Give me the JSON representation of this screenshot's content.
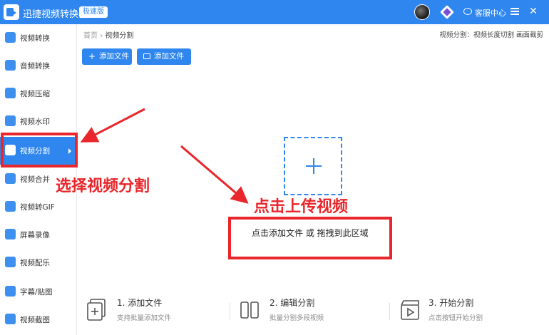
{
  "titlebar": {
    "app_title": "迅捷视频转换器",
    "edition": "极速版",
    "service_label": "客服中心",
    "close_glyph": "✕"
  },
  "sidebar": {
    "items": [
      {
        "label": "视频转换",
        "icon": "video-convert-icon"
      },
      {
        "label": "音频转换",
        "icon": "audio-convert-icon"
      },
      {
        "label": "视频压缩",
        "icon": "video-compress-icon"
      },
      {
        "label": "视频水印",
        "icon": "video-watermark-icon"
      },
      {
        "label": "视频分割",
        "icon": "video-split-icon",
        "active": true
      },
      {
        "label": "视频合并",
        "icon": "video-merge-icon"
      },
      {
        "label": "视频转GIF",
        "icon": "video-gif-icon"
      },
      {
        "label": "屏幕录像",
        "icon": "screen-record-icon"
      },
      {
        "label": "视频配乐",
        "icon": "video-music-icon"
      },
      {
        "label": "字幕/贴图",
        "icon": "subtitle-sticker-icon"
      },
      {
        "label": "视频截图",
        "icon": "video-screenshot-icon"
      }
    ]
  },
  "breadcrumb": {
    "home": "首页",
    "separator": "›",
    "current": "视频分割"
  },
  "header_hint": {
    "prefix": "视频分割：",
    "modes": "视频长度切割 画面裁剪"
  },
  "toolbar": {
    "add_file_label": "添加文件",
    "add_file_glyph": "+",
    "add_folder_label": "添加文件夹"
  },
  "dropzone": {
    "text": "点击添加文件 或 拖拽到此区域"
  },
  "steps": [
    {
      "title": "1. 添加文件",
      "desc": "支持批量添加文件",
      "icon": "add-file-icon"
    },
    {
      "title": "2. 编辑分割",
      "desc": "批量分割多段视频",
      "icon": "edit-split-icon"
    },
    {
      "title": "3. 开始分割",
      "desc": "点击按钮开始分割",
      "icon": "start-split-icon"
    }
  ],
  "annotations": {
    "select_text": "选择视频分割",
    "upload_text": "点击上传视频",
    "color": "#e8262b"
  },
  "colors": {
    "accent": "#2f86ee",
    "annotation": "#e8262b"
  }
}
